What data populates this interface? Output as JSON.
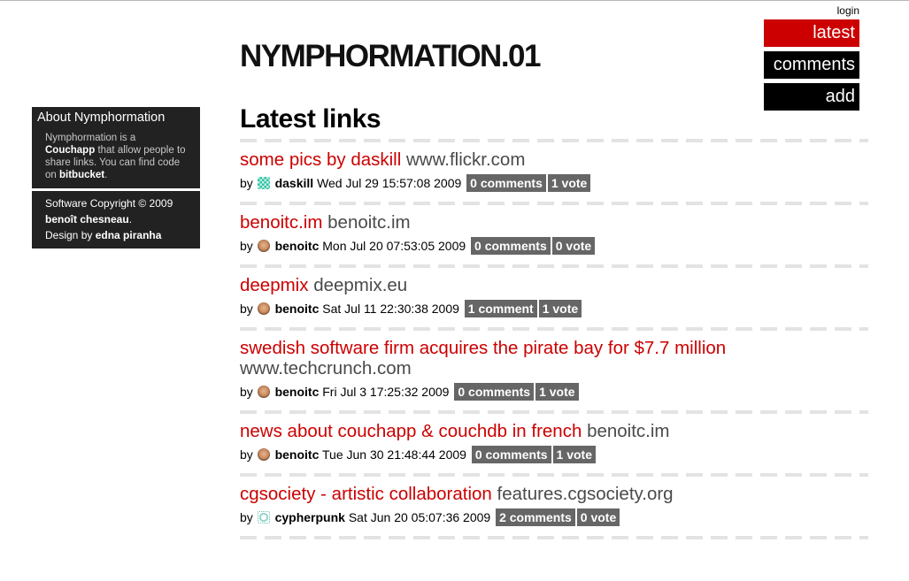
{
  "header": {
    "login_label": "login",
    "nav": [
      {
        "label": "latest",
        "active": true
      },
      {
        "label": "comments",
        "active": false
      },
      {
        "label": "add",
        "active": false
      }
    ],
    "site_title": "NYMPHORMATION.01"
  },
  "sidebar": {
    "about_title": "About Nymphormation",
    "about_text_1": "Nymphormation is a",
    "about_link_couchapp": "Couchapp",
    "about_text_2": "that allow people to share links. You can find code on",
    "about_link_bitbucket": "bitbucket",
    "about_text_3": ".",
    "copyright_text": "Software Copyright © 2009",
    "copyright_author": "benoît chesneau",
    "copyright_end": ".",
    "design_text": "Design by",
    "design_author": "edna piranha"
  },
  "main": {
    "heading": "Latest links",
    "by_label": "by",
    "items": [
      {
        "title": "some pics by daskill",
        "domain": "www.flickr.com",
        "user": "daskill",
        "avatar": "pixel-avatar-icon",
        "date": "Wed Jul 29 15:57:08 2009",
        "comments": "0 comments",
        "votes": "1 vote"
      },
      {
        "title": "benoitc.im",
        "domain": "benoitc.im",
        "user": "benoitc",
        "avatar": "face-avatar-icon",
        "date": "Mon Jul 20 07:53:05 2009",
        "comments": "0 comments",
        "votes": "0 vote"
      },
      {
        "title": "deepmix",
        "domain": "deepmix.eu",
        "user": "benoitc",
        "avatar": "face-avatar-icon",
        "date": "Sat Jul 11 22:30:38 2009",
        "comments": "1 comment",
        "votes": "1 vote"
      },
      {
        "title": "swedish software firm acquires the pirate bay for $7.7 million",
        "domain": "www.techcrunch.com",
        "user": "benoitc",
        "avatar": "face-avatar-icon",
        "date": "Fri Jul 3 17:25:32 2009",
        "comments": "0 comments",
        "votes": "1 vote"
      },
      {
        "title": "news about couchapp & couchdb in french",
        "domain": "benoitc.im",
        "user": "benoitc",
        "avatar": "face-avatar-icon",
        "date": "Tue Jun 30 21:48:44 2009",
        "comments": "0 comments",
        "votes": "1 vote"
      },
      {
        "title": "cgsociety - artistic collaboration",
        "domain": "features.cgsociety.org",
        "user": "cypherpunk",
        "avatar": "ring-avatar-icon",
        "date": "Sat Jun 20 05:07:36 2009",
        "comments": "2 comments",
        "votes": "0 vote"
      }
    ]
  },
  "colors": {
    "accent": "#cc0000",
    "nav_bg": "#000000",
    "sidebar_bg": "#222222",
    "badge_bg": "#666666",
    "domain_text": "#4a4a4a"
  }
}
